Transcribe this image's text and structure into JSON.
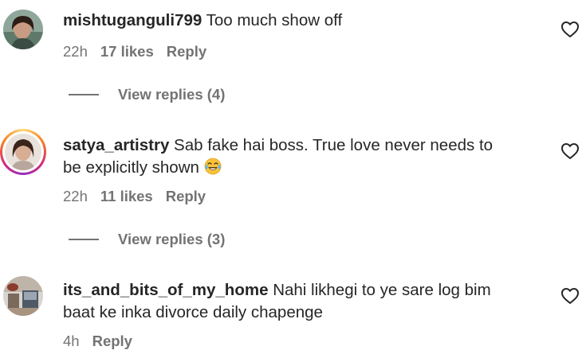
{
  "comments": [
    {
      "username": "mishtuganguli799",
      "text": "Too much show off",
      "time": "22h",
      "likes": "17 likes",
      "reply": "Reply",
      "view_replies": "View replies (4)",
      "avatar_ring": false
    },
    {
      "username": "satya_artistry",
      "text_line1": "Sab fake hai boss. True love never needs to",
      "text_line2": "be explicitly shown",
      "emoji": "face-with-tears-of-joy",
      "time": "22h",
      "likes": "11 likes",
      "reply": "Reply",
      "view_replies": "View replies (3)",
      "avatar_ring": true
    },
    {
      "username": "its_and_bits_of_my_home",
      "text_line1": "Nahi likhegi to ye sare log bim",
      "text_line2": "baat ke inka divorce daily chapenge",
      "time": "4h",
      "reply": "Reply",
      "avatar_ring": false
    }
  ],
  "icons": {
    "like": "heart-outline-icon"
  },
  "colors": {
    "text": "#262626",
    "secondary": "#737373",
    "background": "#ffffff"
  }
}
